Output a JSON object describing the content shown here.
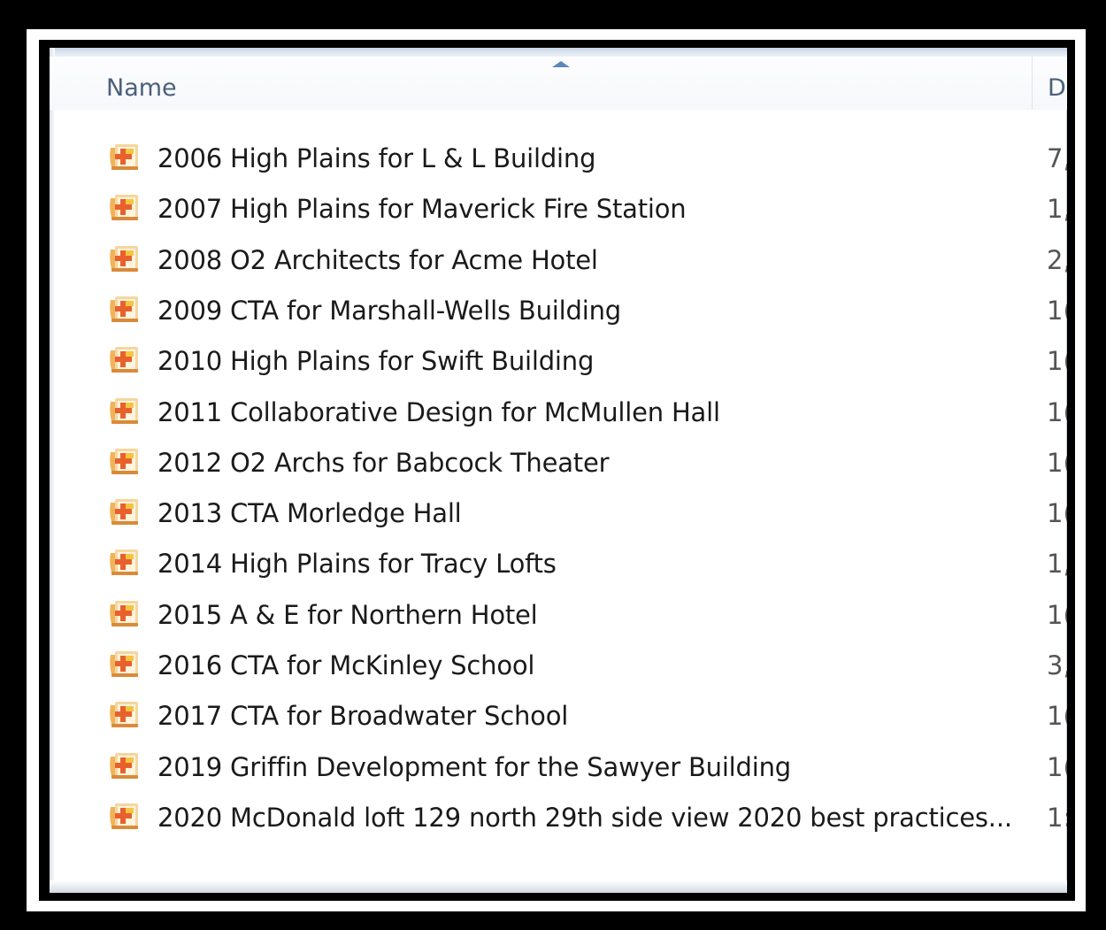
{
  "columns": {
    "name_label": "Name",
    "date_label": "D"
  },
  "icon": "presentation-file-icon",
  "colors": {
    "header_text": "#4c607a",
    "sort_arrow": "#5a86ba",
    "icon_orange": "#e8612c",
    "icon_yellow": "#f5c542"
  },
  "files": [
    {
      "name": "2006 High Plains for L & L Building",
      "date": "7,"
    },
    {
      "name": "2007 High Plains for Maverick Fire Station",
      "date": "1,"
    },
    {
      "name": "2008 O2 Architects for Acme Hotel",
      "date": "2,"
    },
    {
      "name": "2009 CTA for Marshall-Wells Building",
      "date": "1("
    },
    {
      "name": "2010 High Plains for Swift Building",
      "date": "1("
    },
    {
      "name": "2011 Collaborative Design for McMullen Hall",
      "date": "1("
    },
    {
      "name": "2012 O2 Archs for Babcock Theater",
      "date": "1("
    },
    {
      "name": "2013 CTA Morledge Hall",
      "date": "1("
    },
    {
      "name": "2014 High Plains for Tracy Lofts",
      "date": "1,"
    },
    {
      "name": "2015 A & E for Northern Hotel",
      "date": "1("
    },
    {
      "name": "2016 CTA for McKinley School",
      "date": "3,"
    },
    {
      "name": "2017 CTA for Broadwater School",
      "date": "1("
    },
    {
      "name": "2019 Griffin Development for the Sawyer Building",
      "date": "1("
    },
    {
      "name": "2020 McDonald loft 129 north 29th side view 2020 best practices...",
      "date": "1:"
    }
  ]
}
